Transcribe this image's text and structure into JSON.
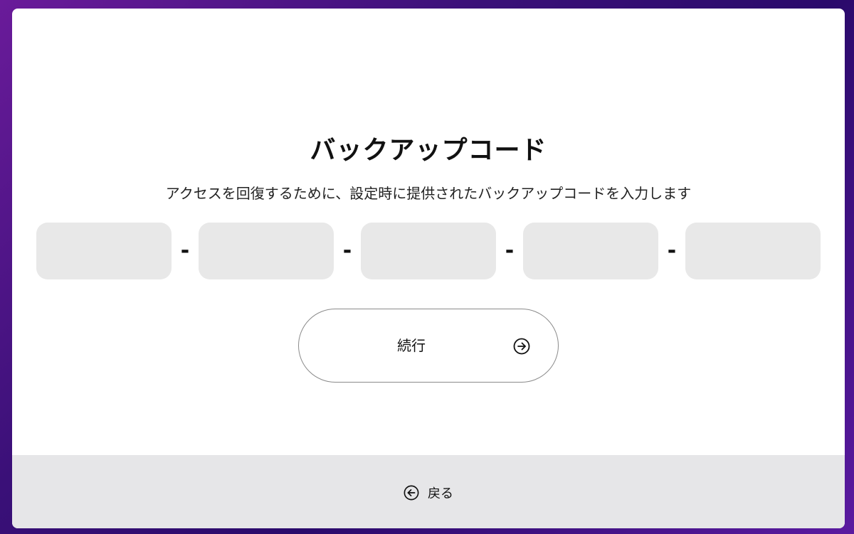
{
  "title": "バックアップコード",
  "subtitle": "アクセスを回復するために、設定時に提供されたバックアップコードを入力します",
  "code": {
    "separator": "-",
    "fields": [
      {
        "value": ""
      },
      {
        "value": ""
      },
      {
        "value": ""
      },
      {
        "value": ""
      },
      {
        "value": ""
      }
    ]
  },
  "continue_button": {
    "label": "続行",
    "icon": "arrow-right-circle-icon"
  },
  "footer": {
    "back_label": "戻る",
    "back_icon": "arrow-left-circle-icon"
  },
  "colors": {
    "input_bg": "#e8e8e8",
    "footer_bg": "#e6e6e8",
    "button_border": "#8a8a8a"
  }
}
